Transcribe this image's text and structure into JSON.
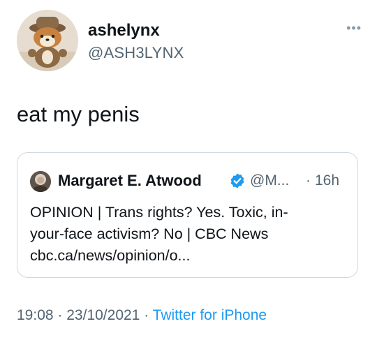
{
  "tweet": {
    "display_name": "ashelynx",
    "handle": "@ASH3LYNX",
    "more_icon": "more-horizontal-icon",
    "text": "eat my penis",
    "time": "19:08",
    "date": "23/10/2021",
    "separator": "·",
    "source": "Twitter for iPhone"
  },
  "quote": {
    "display_name": "Margaret E. Atwood",
    "verified_icon": "verified-badge-icon",
    "handle": "@M...",
    "separator": "·",
    "time": "16h",
    "line1": "OPINION | Trans rights? Yes. Toxic, in-",
    "line2": "your-face activism? No | CBC News",
    "line3": "cbc.ca/news/opinion/o..."
  },
  "colors": {
    "text": "#0f1419",
    "secondary": "#536471",
    "link": "#1d9bf0",
    "border": "#cfd9de"
  }
}
